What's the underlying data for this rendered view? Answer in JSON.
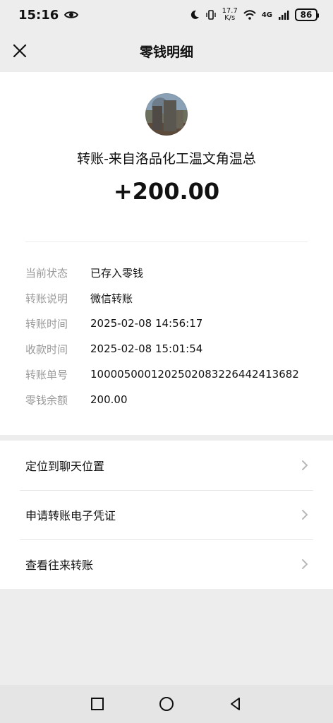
{
  "status": {
    "time": "15:16",
    "eye_icon": "eye-icon",
    "speed_top": "17.7",
    "speed_unit": "K/s",
    "network": "4G",
    "battery": "86"
  },
  "header": {
    "title": "零钱明细",
    "close_icon": "close-icon"
  },
  "transfer": {
    "avatar_icon": "avatar",
    "payer": "转账-来自洛品化工温文角温总",
    "amount": "+200.00",
    "rows": [
      {
        "label": "当前状态",
        "value": "已存入零钱"
      },
      {
        "label": "转账说明",
        "value": "微信转账"
      },
      {
        "label": "转账时间",
        "value": "2025-02-08 14:56:17"
      },
      {
        "label": "收款时间",
        "value": "2025-02-08 15:01:54"
      },
      {
        "label": "转账单号",
        "value": "10000500012025020832264424136​82"
      },
      {
        "label": "零钱余额",
        "value": "200.00"
      }
    ]
  },
  "actions": [
    {
      "label": "定位到聊天位置"
    },
    {
      "label": "申请转账电子凭证"
    },
    {
      "label": "查看往来转账"
    }
  ],
  "navbar": {
    "recent_icon": "square-icon",
    "home_icon": "circle-icon",
    "back_icon": "triangle-back-icon"
  },
  "colors": {
    "background": "#ededed",
    "card": "#ffffff",
    "label_gray": "#9a9a9a",
    "text": "#111111"
  }
}
